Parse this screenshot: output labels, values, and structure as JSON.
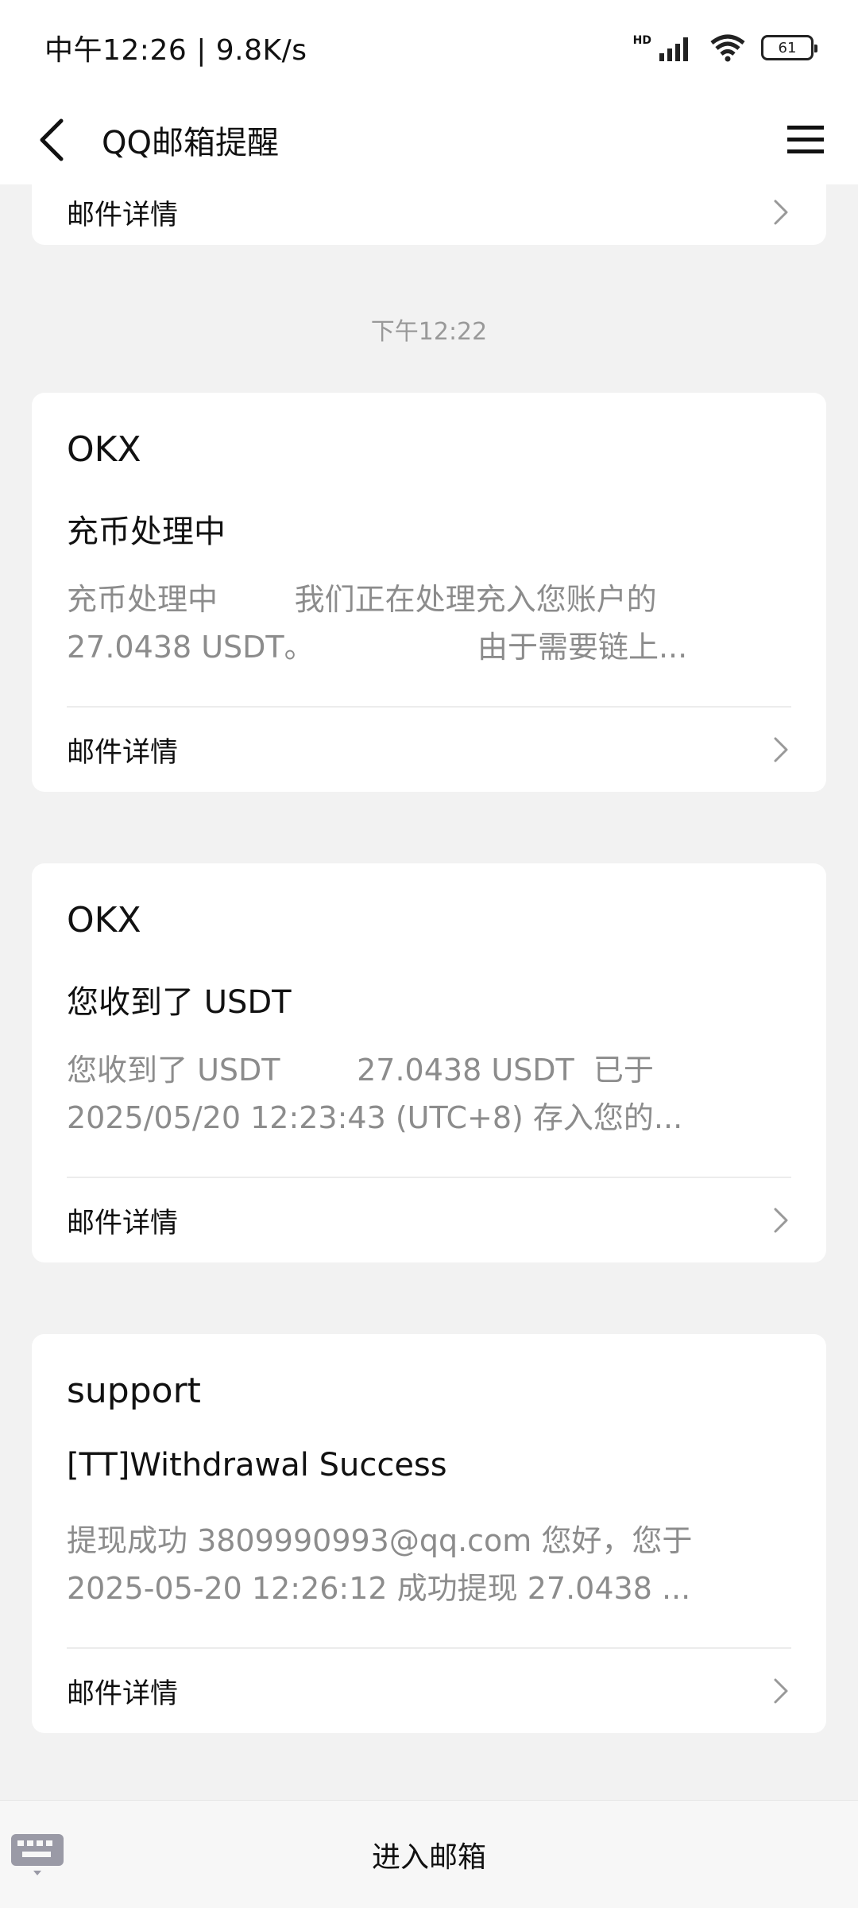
{
  "status_bar": {
    "time_speed": "中午12:26 | 9.8K/s",
    "hd_label": "HD",
    "battery": "61"
  },
  "nav": {
    "title": "QQ邮箱提醒"
  },
  "detail_label": "邮件详情",
  "timestamp": "下午12:22",
  "messages": [
    {
      "sender": "OKX",
      "subject": "充币处理中",
      "preview_line1": "充币处理中        我们正在处理充入您账户的",
      "preview_line2": "27.0438 USDT。                 由于需要链上..."
    },
    {
      "sender": "OKX",
      "subject": "您收到了 USDT",
      "preview_line1": "您收到了 USDT        27.0438 USDT  已于",
      "preview_line2": "2025/05/20 12:23:43 (UTC+8) 存入您的..."
    },
    {
      "sender": "support",
      "subject": "[TT]Withdrawal Success",
      "preview_line1": "提现成功 3809990993@qq.com 您好，您于",
      "preview_line2": "2025-05-20 12:26:12 成功提现 27.0438 ..."
    }
  ],
  "bottom": {
    "enter_label": "进入邮箱"
  },
  "icons": [
    "back-arrow-icon",
    "menu-icon",
    "chevron-right-icon",
    "signal-icon",
    "wifi-icon",
    "battery-icon",
    "keyboard-icon"
  ]
}
